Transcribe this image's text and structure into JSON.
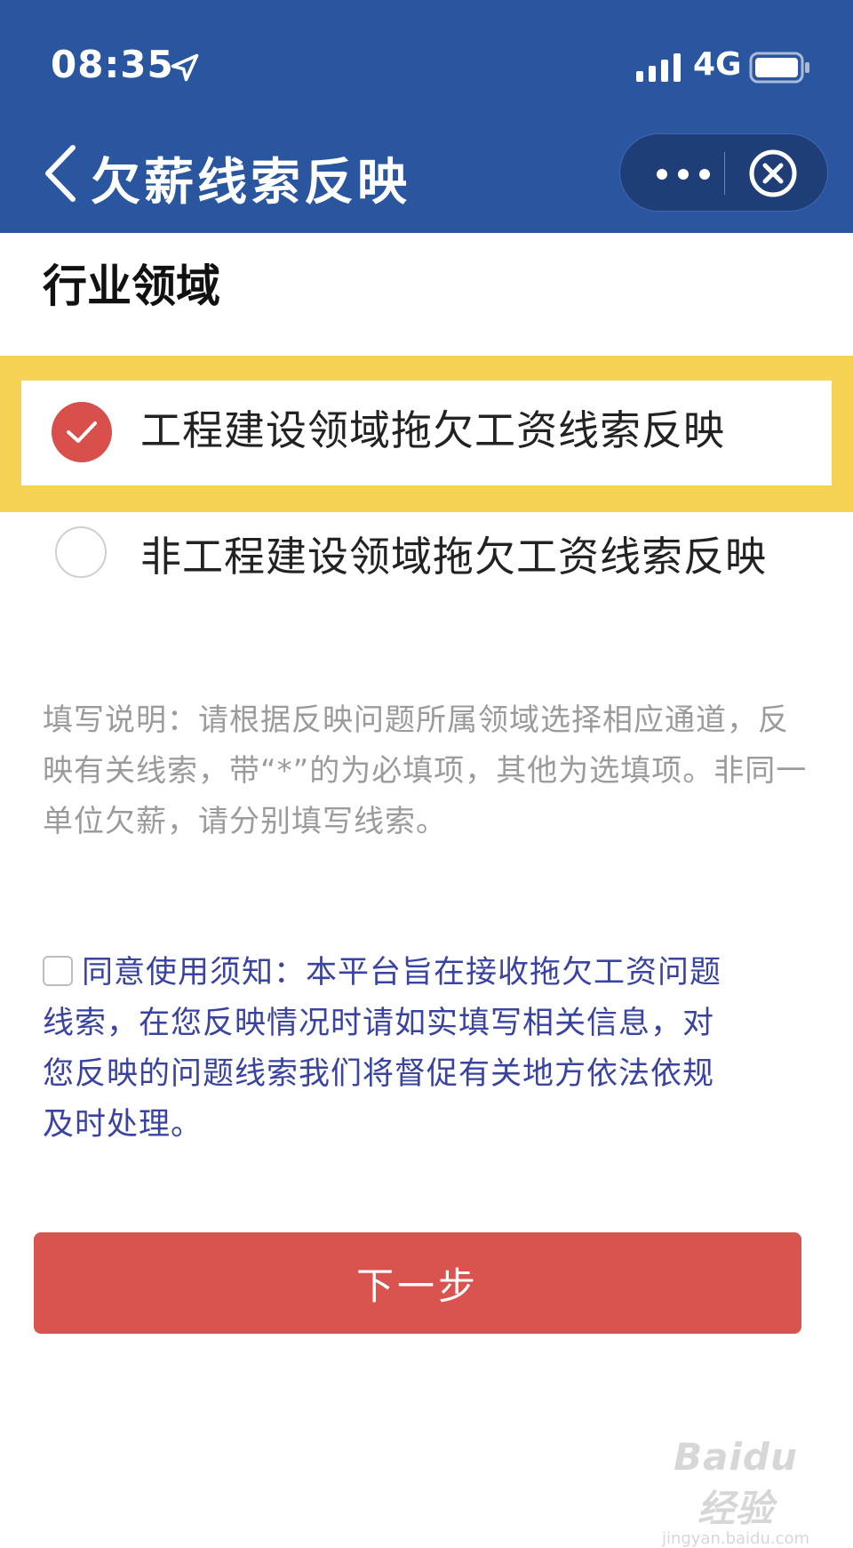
{
  "status_bar": {
    "time": "08:35",
    "network": "4G",
    "icons": [
      "location-arrow-icon",
      "signal-bars-icon",
      "battery-icon"
    ]
  },
  "nav": {
    "title": "欠薪线索反映",
    "back_icon": "chevron-left-icon",
    "more_icon": "more-dots-icon",
    "close_icon": "close-circle-icon"
  },
  "section": {
    "title": "行业领域"
  },
  "options": [
    {
      "label": "工程建设领域拖欠工资线索反映",
      "selected": true
    },
    {
      "label": "非工程建设领域拖欠工资线索反映",
      "selected": false
    }
  ],
  "instruction": "填写说明：请根据反映问题所属领域选择相应通道，反映有关线索，带“*”的为必填项，其他为选填项。非同一单位欠薪，请分别填写线索。",
  "agreement": {
    "checked": false,
    "text": "同意使用须知：本平台旨在接收拖欠工资问题线索，在您反映情况时请如实填写相关信息，对您反映的问题线索我们将督促有关地方依法依规及时处理。"
  },
  "next_button": "下一步",
  "watermark": {
    "logo": "Baidu经验",
    "url": "jingyan.baidu.com"
  },
  "colors": {
    "header": "#2a56a0",
    "highlight": "#f6d355",
    "accent_red": "#d9534f",
    "agreement_text": "#3a44a0"
  }
}
